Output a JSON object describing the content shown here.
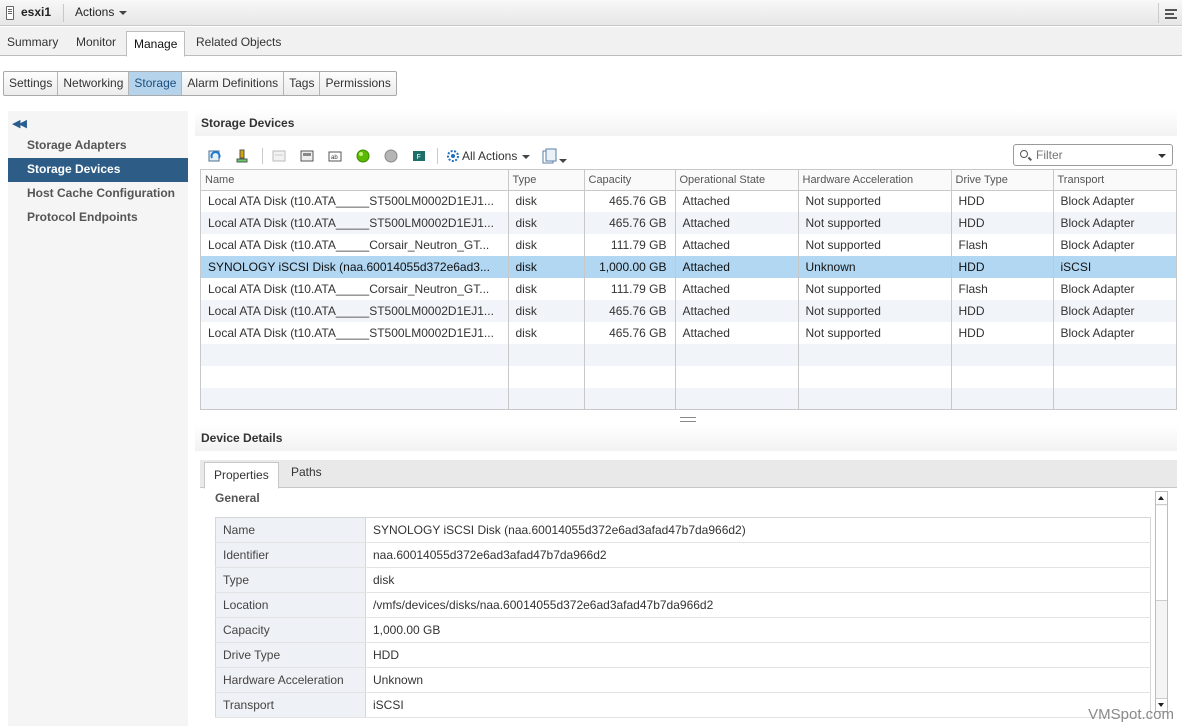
{
  "titlebar": {
    "host": "esxi1",
    "actions_label": "Actions"
  },
  "main_tabs": [
    "Summary",
    "Monitor",
    "Manage",
    "Related Objects"
  ],
  "sub_tabs": [
    "Settings",
    "Networking",
    "Storage",
    "Alarm Definitions",
    "Tags",
    "Permissions"
  ],
  "leftnav": {
    "collapse_icon": "double-chevron-left-icon",
    "items": [
      "Storage Adapters",
      "Storage Devices",
      "Host Cache Configuration",
      "Protocol Endpoints"
    ]
  },
  "storage_devices": {
    "title": "Storage Devices",
    "all_actions_label": "All Actions",
    "filter_placeholder": "Filter",
    "columns": [
      "Name",
      "Type",
      "Capacity",
      "Operational State",
      "Hardware Acceleration",
      "Drive Type",
      "Transport"
    ],
    "rows": [
      [
        "Local ATA Disk (t10.ATA_____ST500LM0002D1EJ1...",
        "disk",
        "465.76 GB",
        "Attached",
        "Not supported",
        "HDD",
        "Block Adapter"
      ],
      [
        "Local ATA Disk (t10.ATA_____ST500LM0002D1EJ1...",
        "disk",
        "465.76 GB",
        "Attached",
        "Not supported",
        "HDD",
        "Block Adapter"
      ],
      [
        "Local ATA Disk (t10.ATA_____Corsair_Neutron_GT...",
        "disk",
        "111.79 GB",
        "Attached",
        "Not supported",
        "Flash",
        "Block Adapter"
      ],
      [
        "SYNOLOGY iSCSI Disk (naa.60014055d372e6ad3...",
        "disk",
        "1,000.00 GB",
        "Attached",
        "Unknown",
        "HDD",
        "iSCSI"
      ],
      [
        "Local ATA Disk (t10.ATA_____Corsair_Neutron_GT...",
        "disk",
        "111.79 GB",
        "Attached",
        "Not supported",
        "Flash",
        "Block Adapter"
      ],
      [
        "Local ATA Disk (t10.ATA_____ST500LM0002D1EJ1...",
        "disk",
        "465.76 GB",
        "Attached",
        "Not supported",
        "HDD",
        "Block Adapter"
      ],
      [
        "Local ATA Disk (t10.ATA_____ST500LM0002D1EJ1...",
        "disk",
        "465.76 GB",
        "Attached",
        "Not supported",
        "HDD",
        "Block Adapter"
      ]
    ]
  },
  "device_details": {
    "title": "Device Details",
    "tabs": [
      "Properties",
      "Paths"
    ],
    "section": "General",
    "properties": [
      [
        "Name",
        "SYNOLOGY iSCSI Disk (naa.60014055d372e6ad3afad47b7da966d2)"
      ],
      [
        "Identifier",
        "naa.60014055d372e6ad3afad47b7da966d2"
      ],
      [
        "Type",
        "disk"
      ],
      [
        "Location",
        "/vmfs/devices/disks/naa.60014055d372e6ad3afad47b7da966d2"
      ],
      [
        "Capacity",
        "1,000.00 GB"
      ],
      [
        "Drive Type",
        "HDD"
      ],
      [
        "Hardware Acceleration",
        "Unknown"
      ],
      [
        "Transport",
        "iSCSI"
      ]
    ]
  },
  "watermark": "VMSpot.com",
  "colors": {
    "selected_row": "#b1d7f2",
    "nav_active": "#2d5d86",
    "tab_active": "#b6d3ec"
  }
}
